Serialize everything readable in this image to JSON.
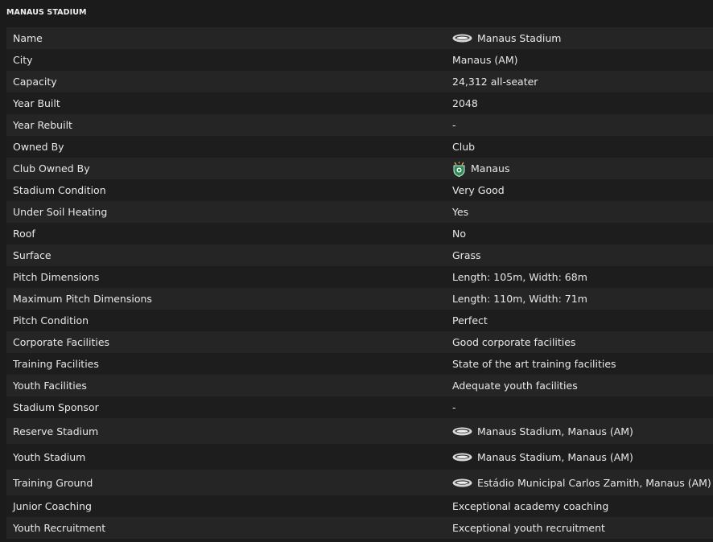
{
  "panel": {
    "title": "MANAUS STADIUM"
  },
  "rows": [
    {
      "label": "Name",
      "value": "Manaus Stadium",
      "icon": "stadium-icon"
    },
    {
      "label": "City",
      "value": "Manaus (AM)"
    },
    {
      "label": "Capacity",
      "value": "24,312 all-seater"
    },
    {
      "label": "Year Built",
      "value": "2048"
    },
    {
      "label": "Year Rebuilt",
      "value": "-"
    },
    {
      "label": "Owned By",
      "value": "Club"
    },
    {
      "label": "Club Owned By",
      "value": "Manaus",
      "icon": "club-crest-icon"
    },
    {
      "label": "Stadium Condition",
      "value": "Very Good"
    },
    {
      "label": "Under Soil Heating",
      "value": "Yes"
    },
    {
      "label": "Roof",
      "value": "No"
    },
    {
      "label": "Surface",
      "value": "Grass"
    },
    {
      "label": "Pitch Dimensions",
      "value": "Length: 105m, Width: 68m"
    },
    {
      "label": "Maximum Pitch Dimensions",
      "value": "Length: 110m, Width: 71m"
    },
    {
      "label": "Pitch Condition",
      "value": "Perfect"
    },
    {
      "label": "Corporate Facilities",
      "value": "Good corporate facilities"
    },
    {
      "label": "Training Facilities",
      "value": "State of the art training facilities"
    },
    {
      "label": "Youth Facilities",
      "value": "Adequate youth facilities"
    },
    {
      "label": "Stadium Sponsor",
      "value": "-"
    },
    {
      "label": "Reserve Stadium",
      "value": "Manaus Stadium, Manaus (AM)",
      "icon": "stadium-icon"
    },
    {
      "label": "Youth Stadium",
      "value": "Manaus Stadium, Manaus (AM)",
      "icon": "stadium-icon"
    },
    {
      "label": "Training Ground",
      "value": "Estádio Municipal Carlos Zamith, Manaus (AM)",
      "icon": "stadium-icon"
    },
    {
      "label": "Junior Coaching",
      "value": "Exceptional academy coaching"
    },
    {
      "label": "Youth Recruitment",
      "value": "Exceptional youth recruitment"
    }
  ],
  "colors": {
    "background": "#1b1b1b",
    "row_odd": "#252525",
    "row_even": "#1d1d1d",
    "text": "#e8e8e8",
    "crest_green": "#2e8b57"
  }
}
